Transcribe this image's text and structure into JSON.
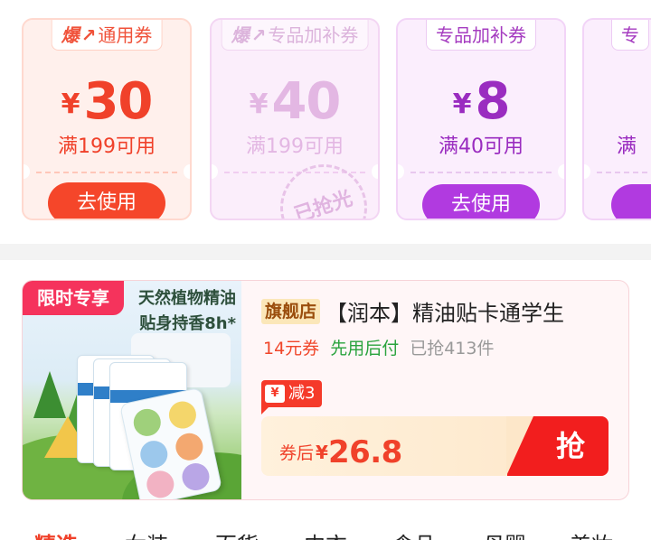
{
  "coupons": [
    {
      "tag_prefix": "爆",
      "tag_label": "通用券",
      "currency": "¥",
      "amount": "30",
      "condition": "满199可用",
      "button": "去使用"
    },
    {
      "tag_prefix": "爆",
      "tag_label": "专品加补券",
      "currency": "¥",
      "amount": "40",
      "condition": "满199可用",
      "stamp": "已抢光"
    },
    {
      "tag_label": "专品加补券",
      "currency": "¥",
      "amount": "8",
      "condition": "满40可用",
      "button": "去使用"
    },
    {
      "tag_label": "专",
      "condition": "满"
    }
  ],
  "product": {
    "limit_tag": "限时专享",
    "image_headline_line1": "天然植物精油",
    "image_headline_line2": "贴身持香8h*",
    "store_badge": "旗舰店",
    "title": "【润本】精油贴卡通学生",
    "coupon_text": "14元券",
    "pay_later": "先用后付",
    "sold": "已抢413件",
    "discount_icon": "¥",
    "discount_label": "减3",
    "price_prefix": "券后",
    "price_currency": "¥",
    "price_value": "26.8",
    "grab_button": "抢"
  },
  "tabs": [
    "精选",
    "女装",
    "百货",
    "内衣",
    "食品",
    "母婴",
    "美妆"
  ],
  "colors": {
    "accent_red": "#f0412a",
    "purple": "#b13ae0",
    "green": "#2aa33e"
  }
}
